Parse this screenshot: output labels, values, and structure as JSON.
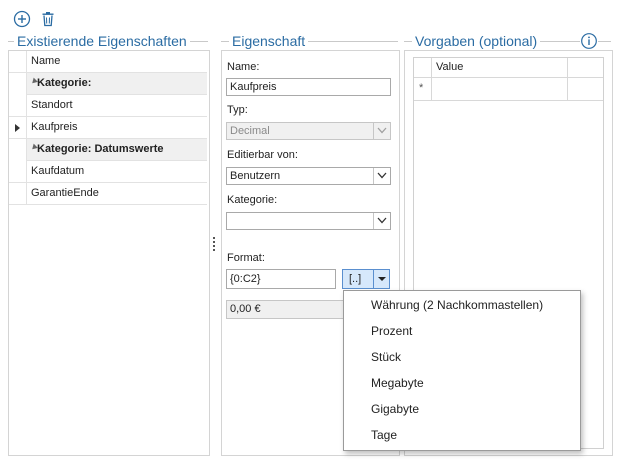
{
  "toolbar": {
    "add_icon": "plus-circle-icon",
    "delete_icon": "trash-icon"
  },
  "left_group": {
    "title": "Existierende Eigenschaften",
    "column_header": "Name",
    "rows": [
      {
        "type": "category",
        "label": "Kategorie:"
      },
      {
        "type": "item",
        "label": "Standort"
      },
      {
        "type": "item",
        "label": "Kaufpreis",
        "current": true
      },
      {
        "type": "category",
        "label": "Kategorie: Datumswerte"
      },
      {
        "type": "item",
        "label": "Kaufdatum"
      },
      {
        "type": "item",
        "label": "GarantieEnde"
      }
    ]
  },
  "middle_group": {
    "title": "Eigenschaft",
    "name_label": "Name:",
    "name_value": "Kaufpreis",
    "type_label": "Typ:",
    "type_value": "Decimal",
    "editable_label": "Editierbar von:",
    "editable_value": "Benutzern",
    "category_label": "Kategorie:",
    "category_value": "",
    "format_label": "Format:",
    "format_value": "{0:C2}",
    "format_button_label": "[..]",
    "preview_value": "0,00 €"
  },
  "right_group": {
    "title": "Vorgaben (optional)",
    "info_icon": "info-icon",
    "column_header": "Value",
    "new_row_marker": "*"
  },
  "format_menu": {
    "items": [
      "Währung (2 Nachkommastellen)",
      "Prozent",
      "Stück",
      "Megabyte",
      "Gigabyte",
      "Tage"
    ]
  },
  "colors": {
    "group_title": "#2b6ca3",
    "button_highlight": "#d6e8fb",
    "button_border": "#5a8fcf"
  }
}
